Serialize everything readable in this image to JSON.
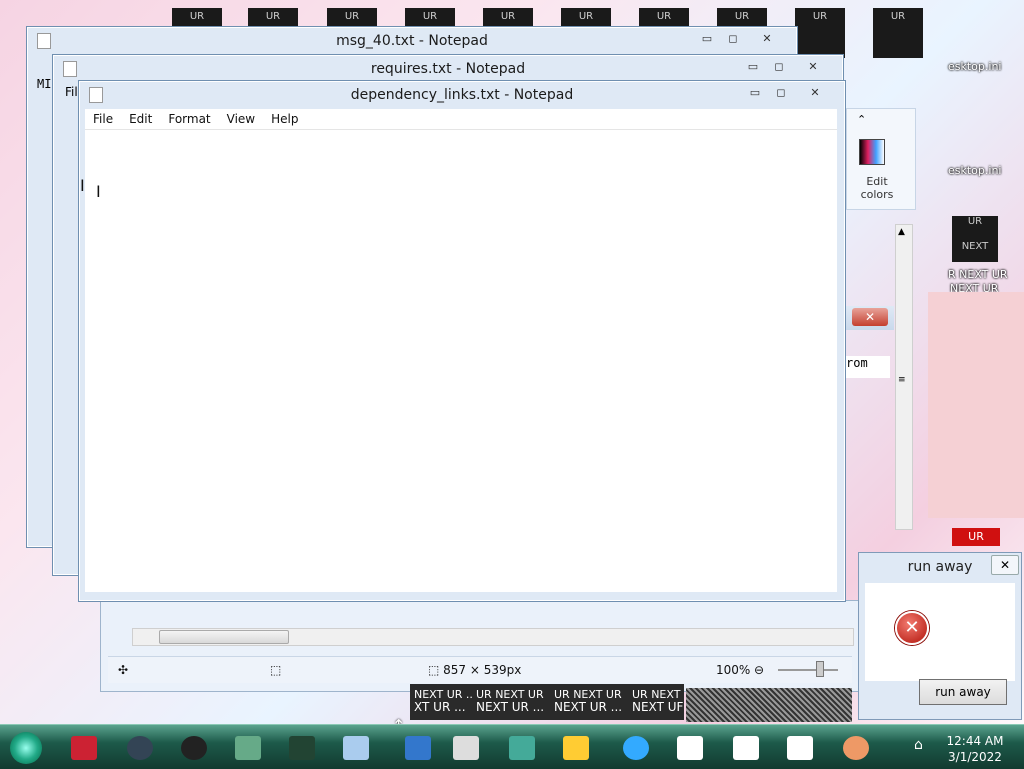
{
  "desktop": {
    "tiles": [
      "UR",
      "UR",
      "UR",
      "UR",
      "UR",
      "UR",
      "UR",
      "UR",
      "UR",
      "UR"
    ],
    "right_tile_top": "UR",
    "right_tile_bottom": "NEXT",
    "right_labels": [
      "esktop.ini",
      "esktop.ini",
      "R NEXT UR",
      "NEXT UR"
    ],
    "red_tile": "UR"
  },
  "windows": {
    "back1": {
      "title": "msg_40.txt - Notepad"
    },
    "back2": {
      "title": "requires.txt - Notepad"
    },
    "main": {
      "title": "dependency_links.txt - Notepad",
      "menu": [
        "File",
        "Edit",
        "Format",
        "View",
        "Help"
      ],
      "content": ""
    }
  },
  "paint_window": {
    "edit_colors_label": "Edit colors",
    "text_fragment": "rom",
    "status": {
      "size": "857 × 539px",
      "zoom": "100%"
    }
  },
  "back_window_left_fragments": {
    "fil": "Fil",
    "mi": "MI"
  },
  "preview_labels": [
    {
      "top": "NEXT UR ..",
      "bottom": "XT UR ..."
    },
    {
      "top": "UR NEXT UR",
      "bottom": "NEXT UR ..."
    },
    {
      "top": "UR NEXT UR",
      "bottom": "NEXT UR ..."
    },
    {
      "top": "UR NEXT",
      "bottom": "NEXT UF"
    }
  ],
  "dialog": {
    "title": "run away",
    "button": "run away",
    "close": "✕"
  },
  "taskbar": {
    "time": "12:44 AM",
    "date": "3/1/2022"
  },
  "colors": {
    "taskbar": "#1d5a4a",
    "error_red": "#c4140b",
    "desktop_pink": "#f6d4e3"
  }
}
